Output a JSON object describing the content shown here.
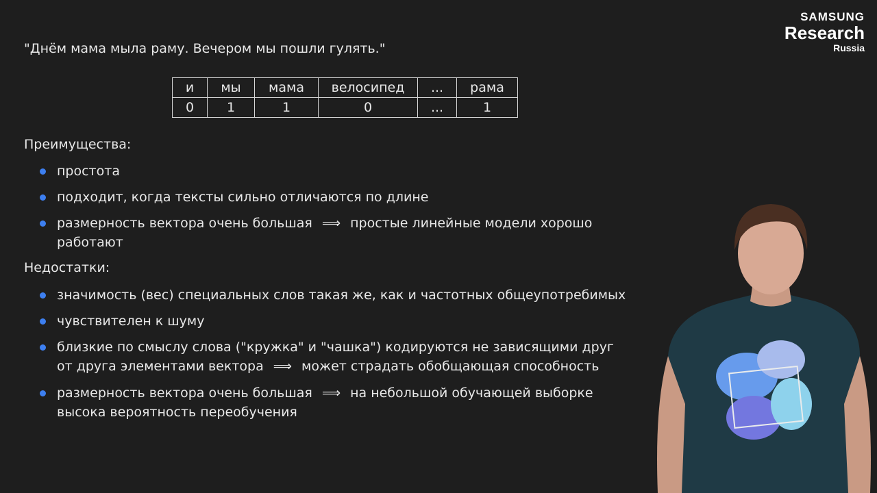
{
  "logo": {
    "line1": "SAMSUNG",
    "line2": "Research",
    "line3": "Russia"
  },
  "quote": "\"Днём мама мыла раму. Вечером мы пошли гулять.\"",
  "table": {
    "header": [
      "и",
      "мы",
      "мама",
      "велосипед",
      "...",
      "рама"
    ],
    "values": [
      "0",
      "1",
      "1",
      "0",
      "...",
      "1"
    ]
  },
  "advantages": {
    "heading": "Преимущества:",
    "items": [
      {
        "line1": "простота"
      },
      {
        "line1": "подходит, когда тексты сильно отличаются по длине"
      },
      {
        "line1a": "размерность вектора очень большая",
        "arrow": "⟹",
        "line1b": "простые линейные модели хорошо",
        "line2": "работают"
      }
    ]
  },
  "disadvantages": {
    "heading": "Недостатки:",
    "items": [
      {
        "line1": "значимость (вес) специальных слов такая же, как и частотных общеупотребимых"
      },
      {
        "line1": "чувствителен к шуму"
      },
      {
        "line1": "близкие по смыслу слова (\"кружка\" и \"чашка\") кодируются не зависящими друг",
        "line2a": "от друга элементами вектора",
        "arrow": "⟹",
        "line2b": "может страдать обобщающая способность"
      },
      {
        "line1a": "размерность вектора очень большая",
        "arrow": "⟹",
        "line1b": "на небольшой обучающей выборке",
        "line2": "высока вероятность переобучения"
      }
    ]
  },
  "colors": {
    "background": "#1e1e1e",
    "bullet": "#3d7ff0",
    "text": "#e8e8e8"
  },
  "icons": {
    "bullet": "bullet-dot-icon"
  }
}
